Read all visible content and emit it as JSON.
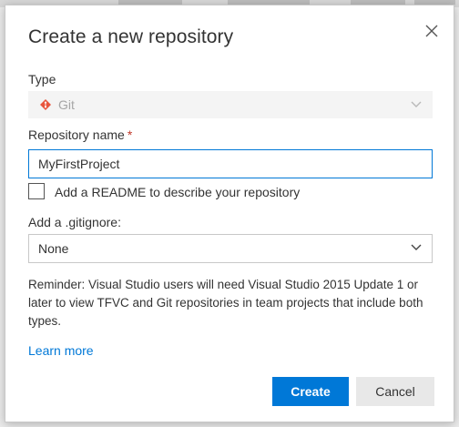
{
  "dialog": {
    "title": "Create a new repository",
    "type_label": "Type",
    "type_value": "Git",
    "repo_name_label": "Repository name",
    "required_marker": "*",
    "repo_name_value": "MyFirstProject",
    "readme_label": "Add a README to describe your repository",
    "readme_checked": false,
    "gitignore_label": "Add a .gitignore:",
    "gitignore_value": "None",
    "reminder": "Reminder: Visual Studio users will need Visual Studio 2015 Update 1 or later to view TFVC and Git repositories in team projects that include both types.",
    "learn_more": "Learn more",
    "create_label": "Create",
    "cancel_label": "Cancel"
  },
  "icons": {
    "close": "close-icon",
    "git": "git-icon",
    "chevron": "chevron-down-icon"
  },
  "colors": {
    "accent": "#0078d7",
    "git_orange": "#e8553d",
    "required_red": "#c0392b"
  }
}
